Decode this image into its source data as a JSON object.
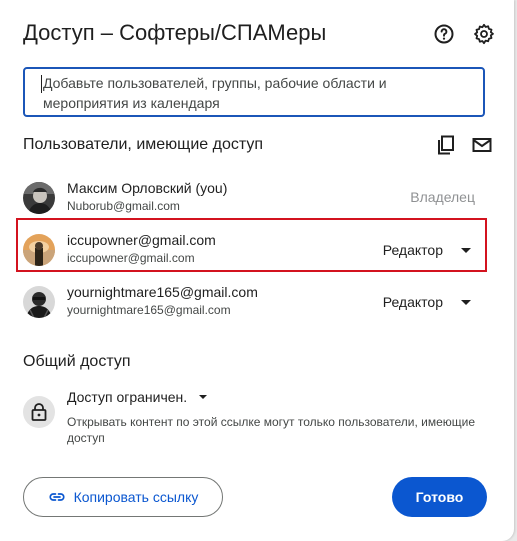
{
  "dialog": {
    "title": "Доступ – Софтеры/СПАМеры",
    "help_icon": "help-circle-icon",
    "settings_icon": "gear-icon"
  },
  "add_people": {
    "placeholder": "Добавьте пользователей, группы, рабочие области и мероприятия из календаря",
    "value": ""
  },
  "people_section": {
    "title": "Пользователи, имеющие доступ",
    "copy_emails_icon": "copy-icon",
    "email_icon": "mail-icon",
    "people": [
      {
        "name": "Максим Орловский (you)",
        "email": "Nuborub@gmail.com",
        "role": "Владелец",
        "avatar": "avatar-photo"
      },
      {
        "name": "iccupowner@gmail.com",
        "email": "iccupowner@gmail.com",
        "role": "Редактор",
        "avatar": "avatar-photo"
      },
      {
        "name": "yournightmare165@gmail.com",
        "email": "yournightmare165@gmail.com",
        "role": "Редактор",
        "avatar": "avatar-photo"
      }
    ]
  },
  "general_access": {
    "title": "Общий доступ",
    "icon": "lock-icon",
    "option": "Доступ ограничен.",
    "description": "Открывать контент по этой ссылке могут только пользователи, имеющие доступ"
  },
  "footer": {
    "copy_link_label": "Копировать ссылку",
    "copy_link_icon": "link-icon",
    "done_label": "Готово"
  },
  "colors": {
    "accent": "#0b57d0",
    "focus_border": "#1b56b8",
    "highlight": "#d3131f"
  }
}
